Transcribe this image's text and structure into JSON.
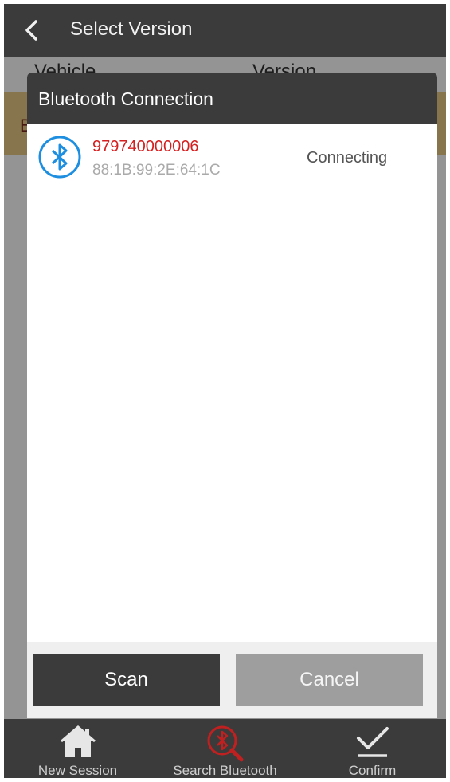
{
  "topbar": {
    "title": "Select Version"
  },
  "table": {
    "header_vehicle": "Vehicle",
    "header_version": "Version",
    "row_initial": "B"
  },
  "dialog": {
    "title": "Bluetooth Connection",
    "device": {
      "name": "979740000006",
      "mac": "88:1B:99:2E:64:1C",
      "status": "Connecting"
    },
    "scan_label": "Scan",
    "cancel_label": "Cancel"
  },
  "bottom_nav": {
    "items": [
      {
        "label": "New Session",
        "icon": "home-icon"
      },
      {
        "label": "Search Bluetooth",
        "icon": "bluetooth-search-icon"
      },
      {
        "label": "Confirm",
        "icon": "checkmark-icon"
      }
    ]
  },
  "colors": {
    "bar": "#3b3b3b",
    "row_highlight": "#e8ca86",
    "device_name": "#d42020",
    "bluetooth_blue": "#1e8fe0",
    "search_red": "#c0201f"
  }
}
